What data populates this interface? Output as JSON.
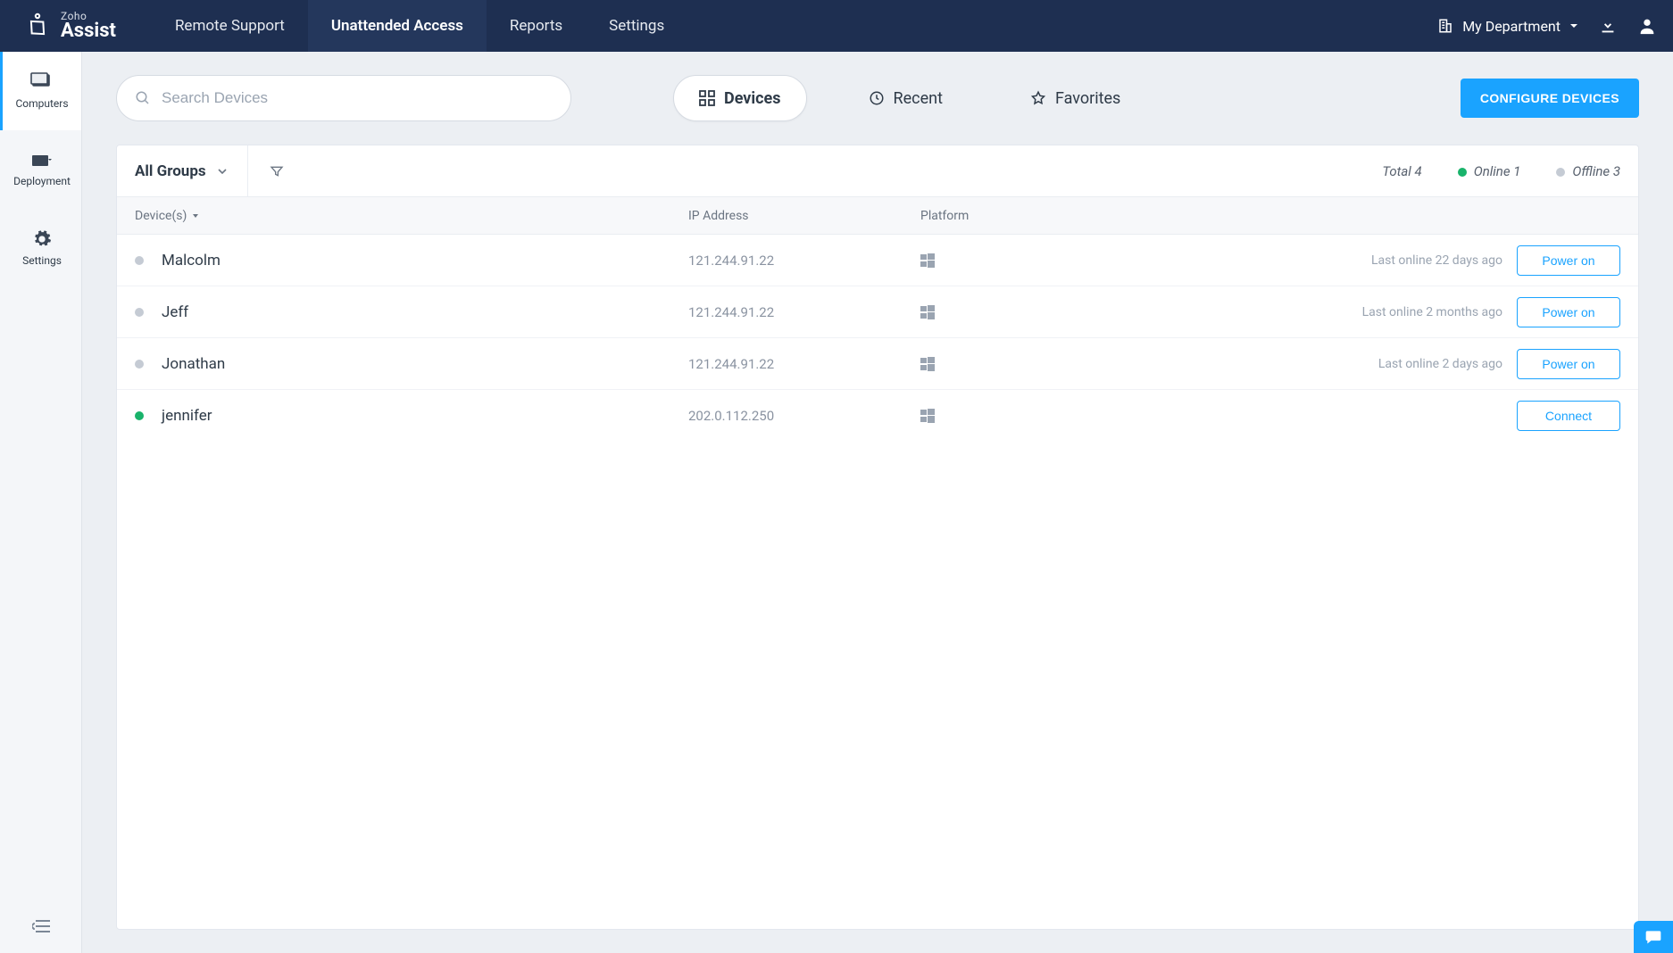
{
  "brand": {
    "top": "Zoho",
    "bottom": "Assist"
  },
  "topnav": {
    "tabs": [
      {
        "label": "Remote Support"
      },
      {
        "label": "Unattended Access"
      },
      {
        "label": "Reports"
      },
      {
        "label": "Settings"
      }
    ],
    "department": "My Department"
  },
  "sidebar": {
    "items": [
      {
        "label": "Computers"
      },
      {
        "label": "Deployment"
      },
      {
        "label": "Settings"
      }
    ]
  },
  "toolbar": {
    "search_placeholder": "Search Devices",
    "tabs": [
      {
        "label": "Devices"
      },
      {
        "label": "Recent"
      },
      {
        "label": "Favorites"
      }
    ],
    "configure_label": "CONFIGURE DEVICES"
  },
  "filters": {
    "group_label": "All Groups",
    "total_label": "Total 4",
    "online_label": "Online 1",
    "offline_label": "Offline 3"
  },
  "columns": {
    "device": "Device(s)",
    "ip": "IP Address",
    "platform": "Platform"
  },
  "rows": [
    {
      "name": "Malcolm",
      "ip": "121.244.91.22",
      "online": false,
      "status": "Last online 22 days ago",
      "action": "Power on"
    },
    {
      "name": "Jeff",
      "ip": "121.244.91.22",
      "online": false,
      "status": "Last online 2 months ago",
      "action": "Power on"
    },
    {
      "name": "Jonathan",
      "ip": "121.244.91.22",
      "online": false,
      "status": "Last online 2 days ago",
      "action": "Power on"
    },
    {
      "name": "jennifer",
      "ip": "202.0.112.250",
      "online": true,
      "status": "",
      "action": "Connect"
    }
  ]
}
